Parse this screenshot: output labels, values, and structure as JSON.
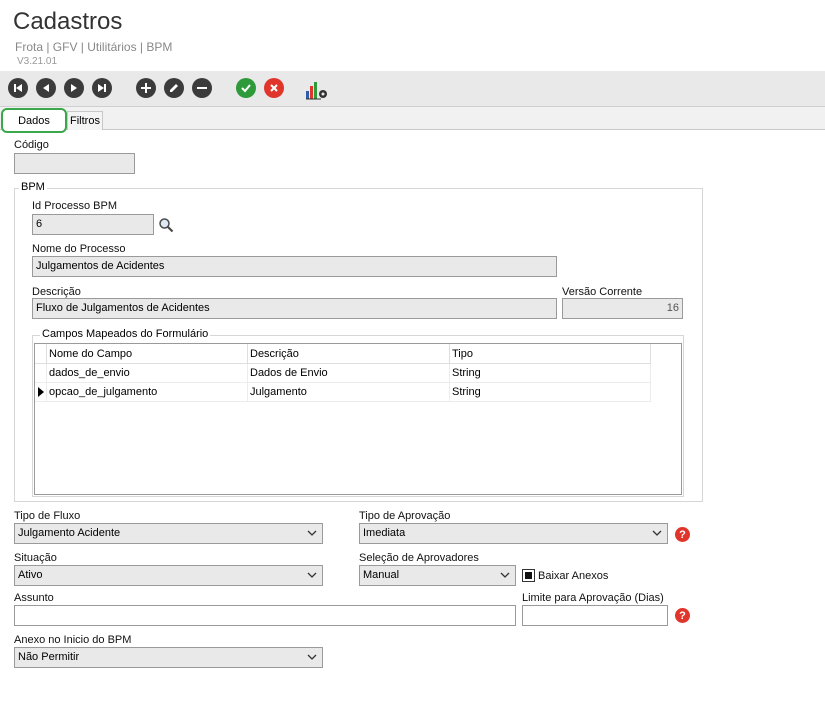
{
  "header": {
    "title": "Cadastros",
    "breadcrumb": "Frota | GFV | Utilitários | BPM",
    "version": "V3.21.01"
  },
  "toolbar": {
    "buttons": [
      "first-icon",
      "previous-icon",
      "next-icon",
      "last-icon",
      "add-icon",
      "edit-icon",
      "remove-icon",
      "confirm-icon",
      "cancel-icon",
      "chart-settings-icon"
    ]
  },
  "tabs": {
    "dados": "Dados",
    "filtros": "Filtros"
  },
  "form": {
    "codigo_label": "Código",
    "codigo_value": "",
    "bpm_legend": "BPM",
    "id_processo_label": "Id Processo BPM",
    "id_processo_value": "6",
    "nome_processo_label": "Nome do Processo",
    "nome_processo_value": "Julgamentos de Acidentes",
    "descricao_label": "Descrição",
    "descricao_value": "Fluxo de Julgamentos de Acidentes",
    "versao_label": "Versão Corrente",
    "versao_value": "16",
    "campos_legend": "Campos Mapeados do Formulário",
    "grid": {
      "headers": [
        "Nome do Campo",
        "Descrição",
        "Tipo"
      ],
      "rows": [
        {
          "nome": "dados_de_envio",
          "descricao": "Dados de Envio",
          "tipo": "String"
        },
        {
          "nome": "opcao_de_julgamento",
          "descricao": "Julgamento",
          "tipo": "String"
        }
      ]
    },
    "tipo_fluxo_label": "Tipo de Fluxo",
    "tipo_fluxo_value": "Julgamento Acidente",
    "tipo_aprovacao_label": "Tipo de Aprovação",
    "tipo_aprovacao_value": "Imediata",
    "situacao_label": "Situação",
    "situacao_value": "Ativo",
    "selecao_label": "Seleção de Aprovadores",
    "selecao_value": "Manual",
    "baixar_anexos_label": "Baixar Anexos",
    "assunto_label": "Assunto",
    "assunto_value": "",
    "limite_label": "Limite para Aprovação (Dias)",
    "limite_value": "",
    "anexo_label": "Anexo no Inicio do BPM",
    "anexo_value": "Não Permitir",
    "help_glyph": "?"
  },
  "colors": {
    "accent_green": "#2e9a3a",
    "accent_red": "#e0352b",
    "tab_active_border": "#3aa74a"
  }
}
